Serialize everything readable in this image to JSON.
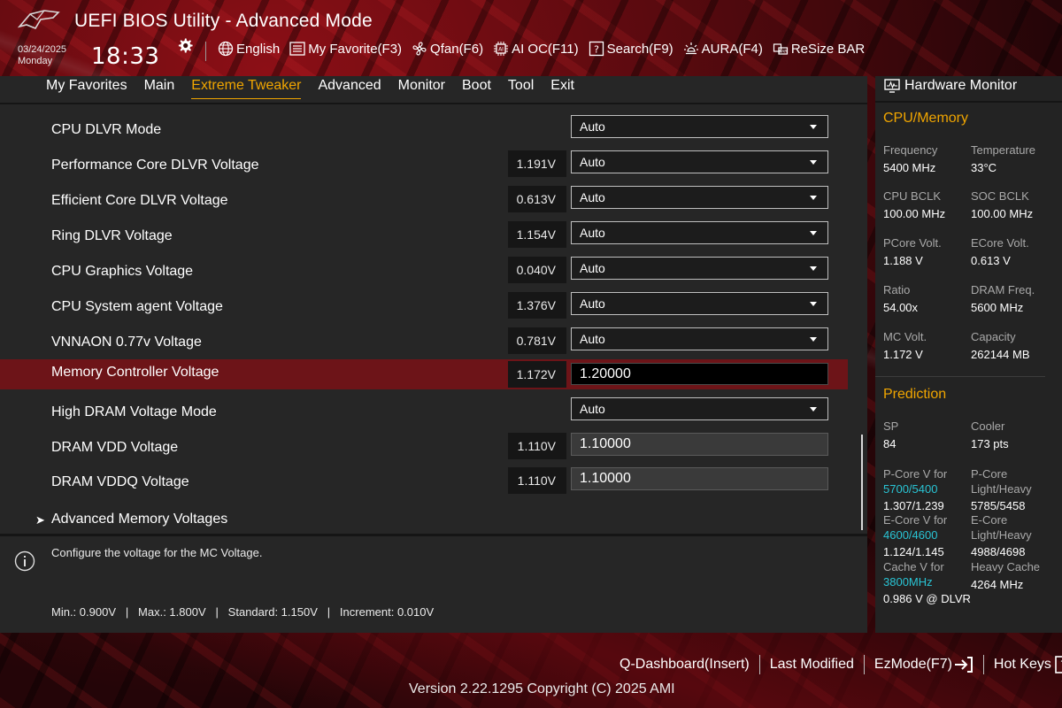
{
  "header": {
    "title": "UEFI BIOS Utility - Advanced Mode",
    "date": "03/24/2025",
    "day": "Monday",
    "time": "18:33",
    "toolbar": [
      {
        "icon": "globe-icon",
        "label": "English"
      },
      {
        "icon": "favorite-list-icon",
        "label": "My Favorite(F3)"
      },
      {
        "icon": "fan-icon",
        "label": "Qfan(F6)"
      },
      {
        "icon": "ai-chip-icon",
        "label": "AI OC(F11)"
      },
      {
        "icon": "search-box-icon",
        "label": "Search(F9)"
      },
      {
        "icon": "aura-light-icon",
        "label": "AURA(F4)"
      },
      {
        "icon": "resize-bar-icon",
        "label": "ReSize BAR"
      }
    ]
  },
  "nav": {
    "tabs": [
      "My Favorites",
      "Main",
      "Extreme Tweaker",
      "Advanced",
      "Monitor",
      "Boot",
      "Tool",
      "Exit"
    ],
    "active": "Extreme Tweaker"
  },
  "settings": [
    {
      "label": "CPU DLVR Mode",
      "voltage": "",
      "type": "dropdown",
      "value": "Auto"
    },
    {
      "label": "Performance Core DLVR Voltage",
      "voltage": "1.191V",
      "type": "dropdown",
      "value": "Auto"
    },
    {
      "label": "Efficient Core DLVR Voltage",
      "voltage": "0.613V",
      "type": "dropdown",
      "value": "Auto"
    },
    {
      "label": "Ring DLVR Voltage",
      "voltage": "1.154V",
      "type": "dropdown",
      "value": "Auto"
    },
    {
      "label": "CPU Graphics Voltage",
      "voltage": "0.040V",
      "type": "dropdown",
      "value": "Auto"
    },
    {
      "label": "CPU System agent Voltage",
      "voltage": "1.376V",
      "type": "dropdown",
      "value": "Auto"
    },
    {
      "label": "VNNAON 0.77v Voltage",
      "voltage": "0.781V",
      "type": "dropdown",
      "value": "Auto"
    },
    {
      "label": "Memory Controller Voltage",
      "voltage": "1.172V",
      "type": "input",
      "value": "1.20000",
      "selected": true
    },
    {
      "label": "High DRAM Voltage Mode",
      "voltage": "",
      "type": "dropdown",
      "value": "Auto"
    },
    {
      "label": "DRAM VDD Voltage",
      "voltage": "1.110V",
      "type": "input-disabled",
      "value": "1.10000"
    },
    {
      "label": "DRAM VDDQ Voltage",
      "voltage": "1.110V",
      "type": "input-disabled",
      "value": "1.10000"
    },
    {
      "label": "Advanced Memory Voltages",
      "voltage": "",
      "type": "submenu",
      "value": ""
    }
  ],
  "help": {
    "description": "Configure the voltage for the MC Voltage.",
    "range": "Min.: 0.900V   |   Max.: 1.800V   |   Standard: 1.150V   |   Increment: 0.010V"
  },
  "hardware_monitor": {
    "title": "Hardware Monitor",
    "cpu_memory": {
      "heading": "CPU/Memory",
      "items": [
        {
          "label": "Frequency",
          "value": "5400 MHz"
        },
        {
          "label": "Temperature",
          "value": "33°C"
        },
        {
          "label": "CPU BCLK",
          "value": "100.00 MHz"
        },
        {
          "label": "SOC BCLK",
          "value": "100.00 MHz"
        },
        {
          "label": "PCore Volt.",
          "value": "1.188 V"
        },
        {
          "label": "ECore Volt.",
          "value": "0.613 V"
        },
        {
          "label": "Ratio",
          "value": "54.00x"
        },
        {
          "label": "DRAM Freq.",
          "value": "5600 MHz"
        },
        {
          "label": "MC Volt.",
          "value": "1.172 V"
        },
        {
          "label": "Capacity",
          "value": "262144 MB"
        }
      ]
    },
    "prediction": {
      "heading": "Prediction",
      "sp_label": "SP",
      "sp_value": "84",
      "cooler_label": "Cooler",
      "cooler_value": "173 pts",
      "pcore_v_label": "P-Core V for",
      "pcore_v_freq": "5700/5400",
      "pcore_v_value": "1.307/1.239",
      "pcore_lh_label1": "P-Core",
      "pcore_lh_label2": "Light/Heavy",
      "pcore_lh_value": "5785/5458",
      "ecore_v_label": "E-Core V for",
      "ecore_v_freq": "4600/4600",
      "ecore_v_value": "1.124/1.145",
      "ecore_lh_label1": "E-Core",
      "ecore_lh_label2": "Light/Heavy",
      "ecore_lh_value": "4988/4698",
      "cache_v_label": "Cache V for",
      "cache_v_freq": "3800MHz",
      "cache_v_value": "0.986 V @ DLVR",
      "heavy_cache_label": "Heavy Cache",
      "heavy_cache_value": "4264 MHz"
    }
  },
  "footer": {
    "qdashboard": "Q-Dashboard(Insert)",
    "last_modified": "Last Modified",
    "ezmode": "EzMode(F7)",
    "hotkeys": "Hot Keys",
    "version": "Version 2.22.1295 Copyright (C) 2025 AMI"
  },
  "colors": {
    "accent": "#f0a500",
    "selected_row": "#6d1418",
    "cyan": "#29c4d4"
  }
}
